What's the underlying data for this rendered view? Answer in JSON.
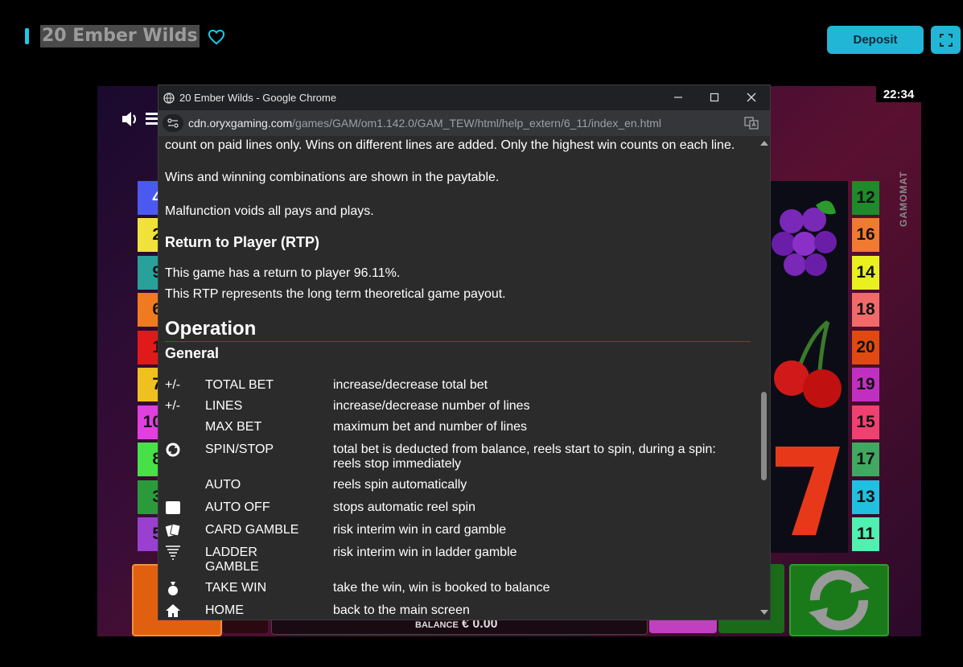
{
  "header": {
    "title": "20 Ember Wilds",
    "deposit_label": "Deposit",
    "accent_color": "#1ec8e8"
  },
  "game": {
    "clock": "22:34",
    "brand": "GAMOMAT",
    "left_lines": [
      "4",
      "2",
      "9",
      "6",
      "1",
      "7",
      "10",
      "8",
      "3",
      "5"
    ],
    "right_lines": [
      "12",
      "16",
      "14",
      "18",
      "20",
      "19",
      "15",
      "17",
      "13",
      "11"
    ]
  },
  "browser": {
    "window_title": "20 Ember Wilds - Google Chrome",
    "url_host": "cdn.oryxgaming.com",
    "url_path": "/games/GAM/om1.142.0/GAM_TEW/html/help_extern/6_11/index_en.html"
  },
  "help": {
    "p1": "count on paid lines only. Wins on different lines are added. Only the highest win counts on each line.",
    "p2": "Wins and winning combinations are shown in the paytable.",
    "p3": "Malfunction voids all pays and plays.",
    "rtp_heading": "Return to Player (RTP)",
    "rtp_line1": "This game has a return to player 96.11%.",
    "rtp_line2": "This RTP represents the long term theoretical game payout.",
    "operation_heading": "Operation",
    "general_heading": "General",
    "controls": [
      {
        "symbol": "+/-",
        "icon": "",
        "key": "TOTAL BET",
        "desc": "increase/decrease total bet"
      },
      {
        "symbol": "+/-",
        "icon": "",
        "key": "LINES",
        "desc": "increase/decrease number of lines"
      },
      {
        "symbol": "",
        "icon": "",
        "key": "MAX BET",
        "desc": "maximum bet and number of lines"
      },
      {
        "symbol": "",
        "icon": "spin-icon",
        "key": "SPIN/STOP",
        "desc": "total bet is deducted from balance, reels start to spin, during a spin: reels stop immediately"
      },
      {
        "symbol": "",
        "icon": "",
        "key": "AUTO",
        "desc": "reels spin automatically"
      },
      {
        "symbol": "",
        "icon": "stop-square-icon",
        "key": "AUTO OFF",
        "desc": "stops automatic reel spin"
      },
      {
        "symbol": "",
        "icon": "cards-icon",
        "key": "CARD GAMBLE",
        "desc": "risk interim win in card gamble"
      },
      {
        "symbol": "",
        "icon": "ladder-icon",
        "key": "LADDER GAMBLE",
        "desc": "risk interim win in ladder gamble"
      },
      {
        "symbol": "",
        "icon": "money-bag-icon",
        "key": "TAKE WIN",
        "desc": "take the win, win is booked to balance"
      },
      {
        "symbol": "",
        "icon": "home-icon",
        "key": "HOME",
        "desc": "back to the main screen"
      }
    ]
  },
  "footer": {
    "balance_label": "BALANCE",
    "balance_value": "€ 0.00"
  }
}
